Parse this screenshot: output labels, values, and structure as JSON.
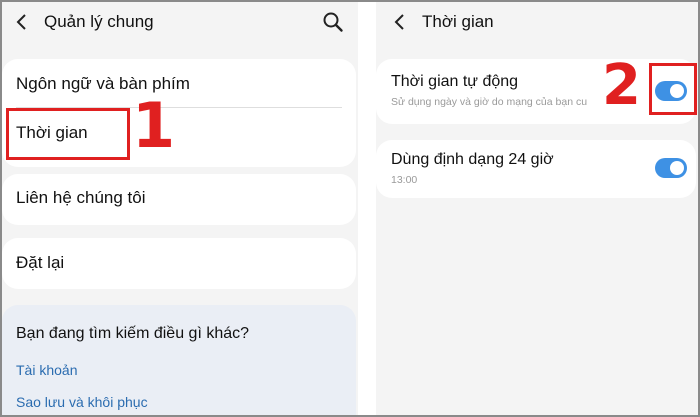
{
  "left": {
    "title": "Quản lý chung",
    "items": [
      {
        "label": "Ngôn ngữ và bàn phím"
      },
      {
        "label": "Thời gian"
      },
      {
        "label": "Liên hệ chúng tôi"
      },
      {
        "label": "Đặt lại"
      }
    ],
    "help": {
      "question": "Bạn đang tìm kiếm điều gì khác?",
      "links": [
        "Tài khoản",
        "Sao lưu và khôi phục"
      ]
    },
    "annotation": "1"
  },
  "right": {
    "title": "Thời gian",
    "settings": [
      {
        "label": "Thời gian tự động",
        "subtitle": "Sử dụng ngày và giờ do mạng của bạn cung cấp",
        "enabled": true
      },
      {
        "label": "Dùng định dạng 24 giờ",
        "subtitle": "13:00",
        "enabled": true
      }
    ],
    "annotation": "2"
  },
  "colors": {
    "accent": "#3e91e4",
    "highlight": "#e02020",
    "link": "#2b6cb0"
  },
  "icons": [
    "back-arrow-icon",
    "search-icon"
  ]
}
